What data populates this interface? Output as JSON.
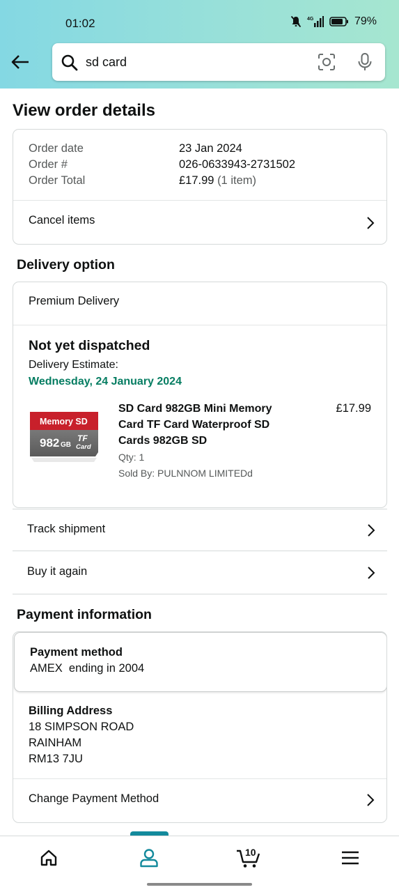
{
  "status_bar": {
    "time": "01:02",
    "battery": "79%",
    "network": "4G"
  },
  "search": {
    "query": "sd card"
  },
  "page_title": "View order details",
  "order_summary": {
    "rows": [
      {
        "key": "Order date",
        "value": "23 Jan 2024"
      },
      {
        "key": "Order #",
        "value": "026-0633943-2731502"
      },
      {
        "key": "Order Total",
        "value": "£17.99",
        "extra": "(1 item)"
      }
    ],
    "cancel_label": "Cancel items"
  },
  "delivery": {
    "section_title": "Delivery option",
    "option": "Premium Delivery",
    "status": "Not yet dispatched",
    "estimate_label": "Delivery Estimate:",
    "estimate_date": "Wednesday, 24 January 2024",
    "product": {
      "title": "SD Card 982GB Mini Memory Card TF Card Waterproof SD Cards 982GB SD",
      "price": "£17.99",
      "qty": "Qty: 1",
      "seller": "Sold By: PULNNOM LIMITEDd",
      "image_text": {
        "top": "Memory SD",
        "capacity": "982",
        "unit": "GB",
        "tf": "TF",
        "card": "Card"
      }
    },
    "track_label": "Track shipment",
    "buy_again_label": "Buy it again"
  },
  "payment": {
    "section_title": "Payment information",
    "method_label": "Payment method",
    "method_value": "AMEX  ending in 2004",
    "billing_label": "Billing Address",
    "address": [
      "18 SIMPSON ROAD",
      "RAINHAM",
      "RM13 7JU"
    ],
    "change_label": "Change Payment Method"
  },
  "bottom_nav": {
    "items": [
      "home",
      "account",
      "cart",
      "menu"
    ],
    "active": "account",
    "cart_count": "10"
  },
  "colors": {
    "accent": "#138a9c",
    "delivery_green": "#067d62",
    "header_start": "#84d8e3",
    "header_end": "#a6e6d0"
  }
}
